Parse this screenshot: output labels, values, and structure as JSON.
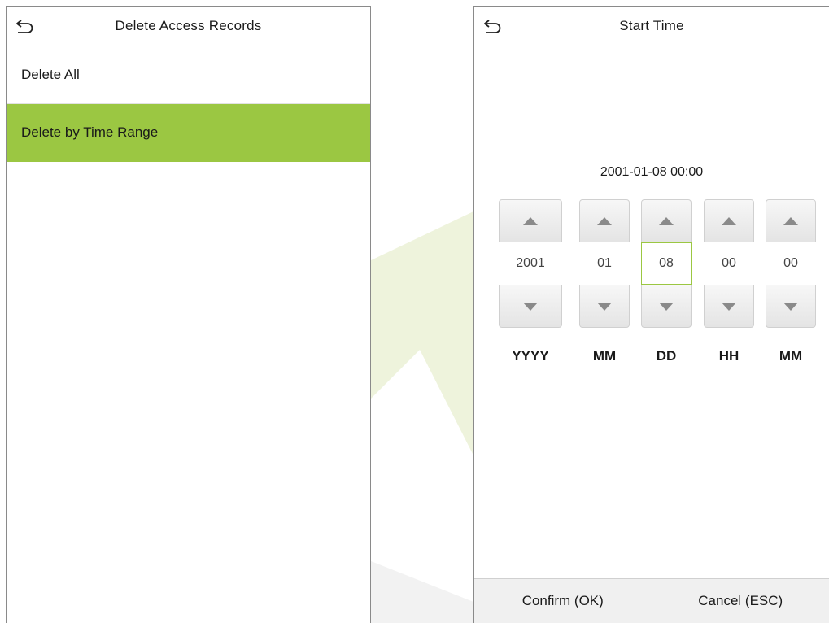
{
  "left_screen": {
    "title": "Delete Access Records",
    "menu": [
      {
        "label": "Delete All",
        "selected": false
      },
      {
        "label": "Delete by Time Range",
        "selected": true
      }
    ]
  },
  "right_screen": {
    "title": "Start Time",
    "current_value": "2001-01-08 00:00",
    "spinners": [
      {
        "value": "2001",
        "unit": "YYYY",
        "active": false
      },
      {
        "value": "01",
        "unit": "MM",
        "active": false
      },
      {
        "value": "08",
        "unit": "DD",
        "active": true
      },
      {
        "value": "00",
        "unit": "HH",
        "active": false
      },
      {
        "value": "00",
        "unit": "MM",
        "active": false
      }
    ],
    "buttons": {
      "confirm": "Confirm (OK)",
      "cancel": "Cancel (ESC)"
    }
  },
  "colors": {
    "accent": "#9bc742",
    "watermark": "#eef3dc"
  }
}
